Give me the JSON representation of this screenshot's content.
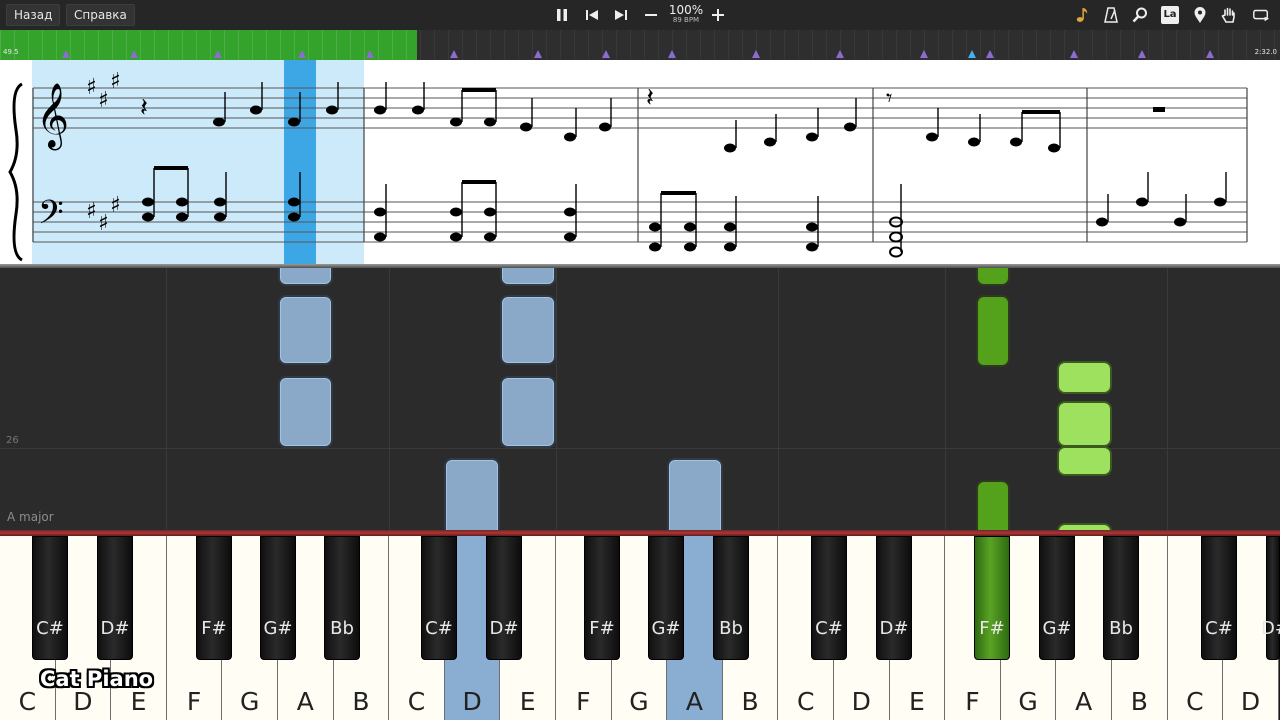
{
  "toolbar": {
    "back_label": "Назад",
    "help_label": "Справка",
    "zoom": "100%",
    "bpm": "89 BPM",
    "notation_badge": "La",
    "icons": [
      "pause-icon",
      "skip-back-icon",
      "skip-forward-icon",
      "minus-icon",
      "plus-icon",
      "note-icon",
      "metronome-icon",
      "search-icon",
      "la-badge-icon",
      "location-pin-icon",
      "hand-icon",
      "loop-icon"
    ]
  },
  "progress": {
    "time_left": "49.5",
    "time_right": "2:32.0",
    "played_fraction": 0.326,
    "fill_color": "#33a32b"
  },
  "roll": {
    "measure_number": "26",
    "key_signature": "A major"
  },
  "keyboard": {
    "white_keys": [
      "C",
      "D",
      "E",
      "F",
      "G",
      "A",
      "B",
      "C",
      "D",
      "E",
      "F",
      "G",
      "A",
      "B",
      "C",
      "D",
      "E",
      "F",
      "G",
      "A",
      "B",
      "C",
      "D"
    ],
    "black_keys": [
      "C#",
      "D#",
      "F#",
      "G#",
      "Bb",
      "C#",
      "D#",
      "F#",
      "G#",
      "Bb",
      "C#",
      "D#",
      "F#",
      "G#",
      "Bb",
      "C#",
      "D#"
    ],
    "highlighted_white": [
      "D",
      "A"
    ],
    "highlighted_black": [
      "F#"
    ],
    "logo": "Cat Piano"
  },
  "colors": {
    "accent_green": "#33a32b",
    "note_blue": "#8aa8c8",
    "note_green": "#54a21c",
    "highlight_blue": "#b9e3f8"
  }
}
